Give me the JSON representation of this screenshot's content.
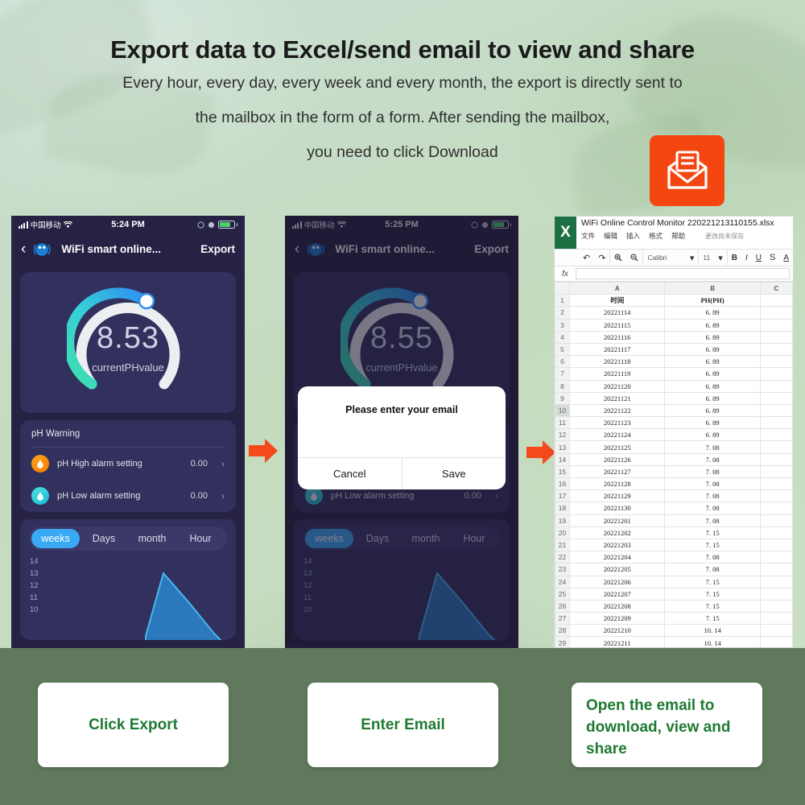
{
  "header": {
    "title": "Export data to Excel/send email to view and share",
    "line1": "Every hour, every day, every week and every month, the export is directly sent to",
    "line2": "the mailbox in the form of a form. After sending the mailbox,",
    "line3": "you need to click Download",
    "mail_icon": "envelope-icon",
    "accent_orange": "#f44611"
  },
  "phone1": {
    "status": {
      "carrier": "中国移动",
      "time": "5:24 PM",
      "wifi": "wifi-icon",
      "battery": "battery-icon"
    },
    "nav": {
      "back": "‹",
      "title": "WiFi smart online...",
      "export": "Export"
    },
    "gauge": {
      "value": "8.53",
      "label": "currentPHvalue"
    },
    "warning": {
      "title": "pH Warning",
      "rows": [
        {
          "icon": "ph-high-drop-icon",
          "label": "pH High alarm setting",
          "value": "0.00",
          "chevron": "›"
        },
        {
          "icon": "ph-low-drop-icon",
          "label": "pH Low alarm setting",
          "value": "0.00",
          "chevron": "›"
        }
      ]
    },
    "chart": {
      "segments": [
        "weeks",
        "Days",
        "month",
        "Hour"
      ],
      "active": "weeks",
      "y_ticks": [
        "14",
        "13",
        "12",
        "11",
        "10"
      ]
    }
  },
  "phone2": {
    "status": {
      "carrier": "中国移动",
      "time": "5:25 PM",
      "wifi": "wifi-icon",
      "battery": "battery-icon"
    },
    "nav": {
      "back": "‹",
      "title": "WiFi smart online...",
      "export": "Export"
    },
    "gauge": {
      "value": "8.55",
      "label": "currentPHvalue"
    },
    "modal": {
      "title": "Please enter your email",
      "input_value": "",
      "cancel": "Cancel",
      "save": "Save"
    },
    "warning": {
      "rows": [
        {
          "icon": "ph-low-drop-icon",
          "label": "pH Low alarm setting",
          "value": "0.00",
          "chevron": "›"
        }
      ]
    },
    "chart": {
      "segments": [
        "weeks",
        "Days",
        "month",
        "Hour"
      ],
      "active": "weeks",
      "y_ticks": [
        "14",
        "13",
        "12",
        "11",
        "10"
      ]
    }
  },
  "excel": {
    "logo": "X",
    "filename": "WiFi Online Control Monitor 220221213110155.xlsx",
    "menu": [
      "文件",
      "编辑",
      "插入",
      "格式",
      "帮助"
    ],
    "save_state": "更改尚未保存",
    "toolbar": {
      "undo": "↶",
      "redo": "↷",
      "zoom_in": "zoom-in-icon",
      "zoom_out": "zoom-out-icon",
      "font": "Calibri",
      "size": "11",
      "bold": "B",
      "italic": "I",
      "underline": "U",
      "strike": "S",
      "font_color": "A"
    },
    "formula_bar": {
      "fx": "fx",
      "value": ""
    },
    "columns": [
      "",
      "A",
      "B",
      "C"
    ],
    "headers": [
      "时间",
      "PH(PH)"
    ],
    "selected_row": "10",
    "rows": [
      {
        "n": "1",
        "a": "时间",
        "b": "PH(PH)"
      },
      {
        "n": "2",
        "a": "20221114",
        "b": "6. 89"
      },
      {
        "n": "3",
        "a": "20221115",
        "b": "6. 89"
      },
      {
        "n": "4",
        "a": "20221116",
        "b": "6. 89"
      },
      {
        "n": "5",
        "a": "20221117",
        "b": "6. 89"
      },
      {
        "n": "6",
        "a": "20221118",
        "b": "6. 89"
      },
      {
        "n": "7",
        "a": "20221119",
        "b": "6. 89"
      },
      {
        "n": "8",
        "a": "20221120",
        "b": "6. 89"
      },
      {
        "n": "9",
        "a": "20221121",
        "b": "6. 89"
      },
      {
        "n": "10",
        "a": "20221122",
        "b": "6. 89"
      },
      {
        "n": "11",
        "a": "20221123",
        "b": "6. 89"
      },
      {
        "n": "12",
        "a": "20221124",
        "b": "6. 89"
      },
      {
        "n": "13",
        "a": "20221125",
        "b": "7. 08"
      },
      {
        "n": "14",
        "a": "20221126",
        "b": "7. 08"
      },
      {
        "n": "15",
        "a": "20221127",
        "b": "7. 08"
      },
      {
        "n": "16",
        "a": "20221128",
        "b": "7. 08"
      },
      {
        "n": "17",
        "a": "20221129",
        "b": "7. 08"
      },
      {
        "n": "18",
        "a": "20221130",
        "b": "7. 08"
      },
      {
        "n": "19",
        "a": "20221201",
        "b": "7. 08"
      },
      {
        "n": "20",
        "a": "20221202",
        "b": "7. 15"
      },
      {
        "n": "21",
        "a": "20221203",
        "b": "7. 15"
      },
      {
        "n": "22",
        "a": "20221204",
        "b": "7. 08"
      },
      {
        "n": "23",
        "a": "20221205",
        "b": "7. 08"
      },
      {
        "n": "24",
        "a": "20221206",
        "b": "7. 15"
      },
      {
        "n": "25",
        "a": "20221207",
        "b": "7. 15"
      },
      {
        "n": "26",
        "a": "20221208",
        "b": "7. 15"
      },
      {
        "n": "27",
        "a": "20221209",
        "b": "7. 15"
      },
      {
        "n": "28",
        "a": "20221210",
        "b": "10. 14"
      },
      {
        "n": "29",
        "a": "20221211",
        "b": "10. 14"
      }
    ]
  },
  "captions": {
    "c1": "Click Export",
    "c2": "Enter Email",
    "c3": "Open the email to download, view and share",
    "color": "#1e7a32"
  },
  "arrows": {
    "arrow1": "right-arrow-icon",
    "arrow2": "right-arrow-icon",
    "color": "#f4491a"
  }
}
